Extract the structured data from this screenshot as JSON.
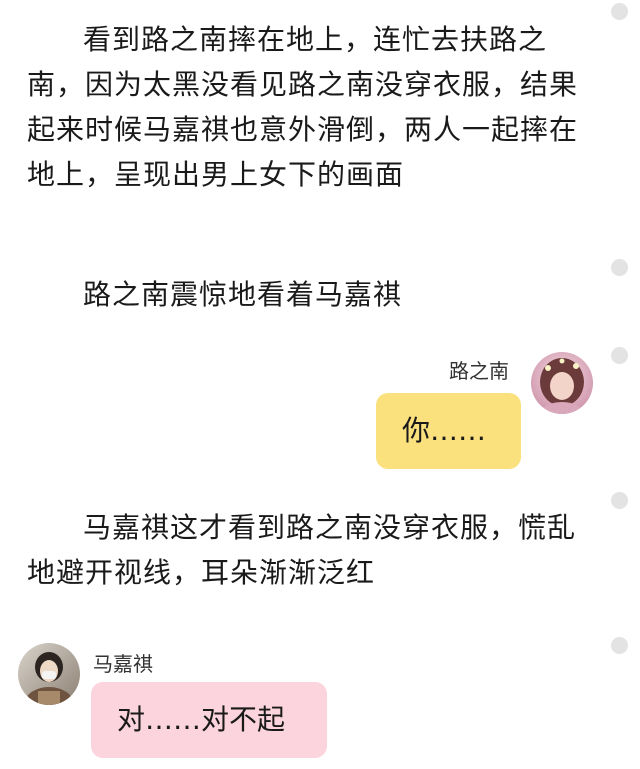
{
  "story": {
    "para1": "看到路之南摔在地上，连忙去扶路之南，因为太黑没看见路之南没穿衣服，结果起来时候马嘉祺也意外滑倒，两人一起摔在地上，呈现出男上女下的画面",
    "para2": "路之南震惊地看着马嘉祺",
    "para3": "马嘉祺这才看到路之南没穿衣服，慌乱地避开视线，耳朵渐渐泛红"
  },
  "dialogue": [
    {
      "speaker": "路之南",
      "text": "你……",
      "side": "right",
      "bubble_color": "#fae17e"
    },
    {
      "speaker": "马嘉祺",
      "text": "对……对不起",
      "side": "left",
      "bubble_color": "#fcd4dd"
    }
  ]
}
